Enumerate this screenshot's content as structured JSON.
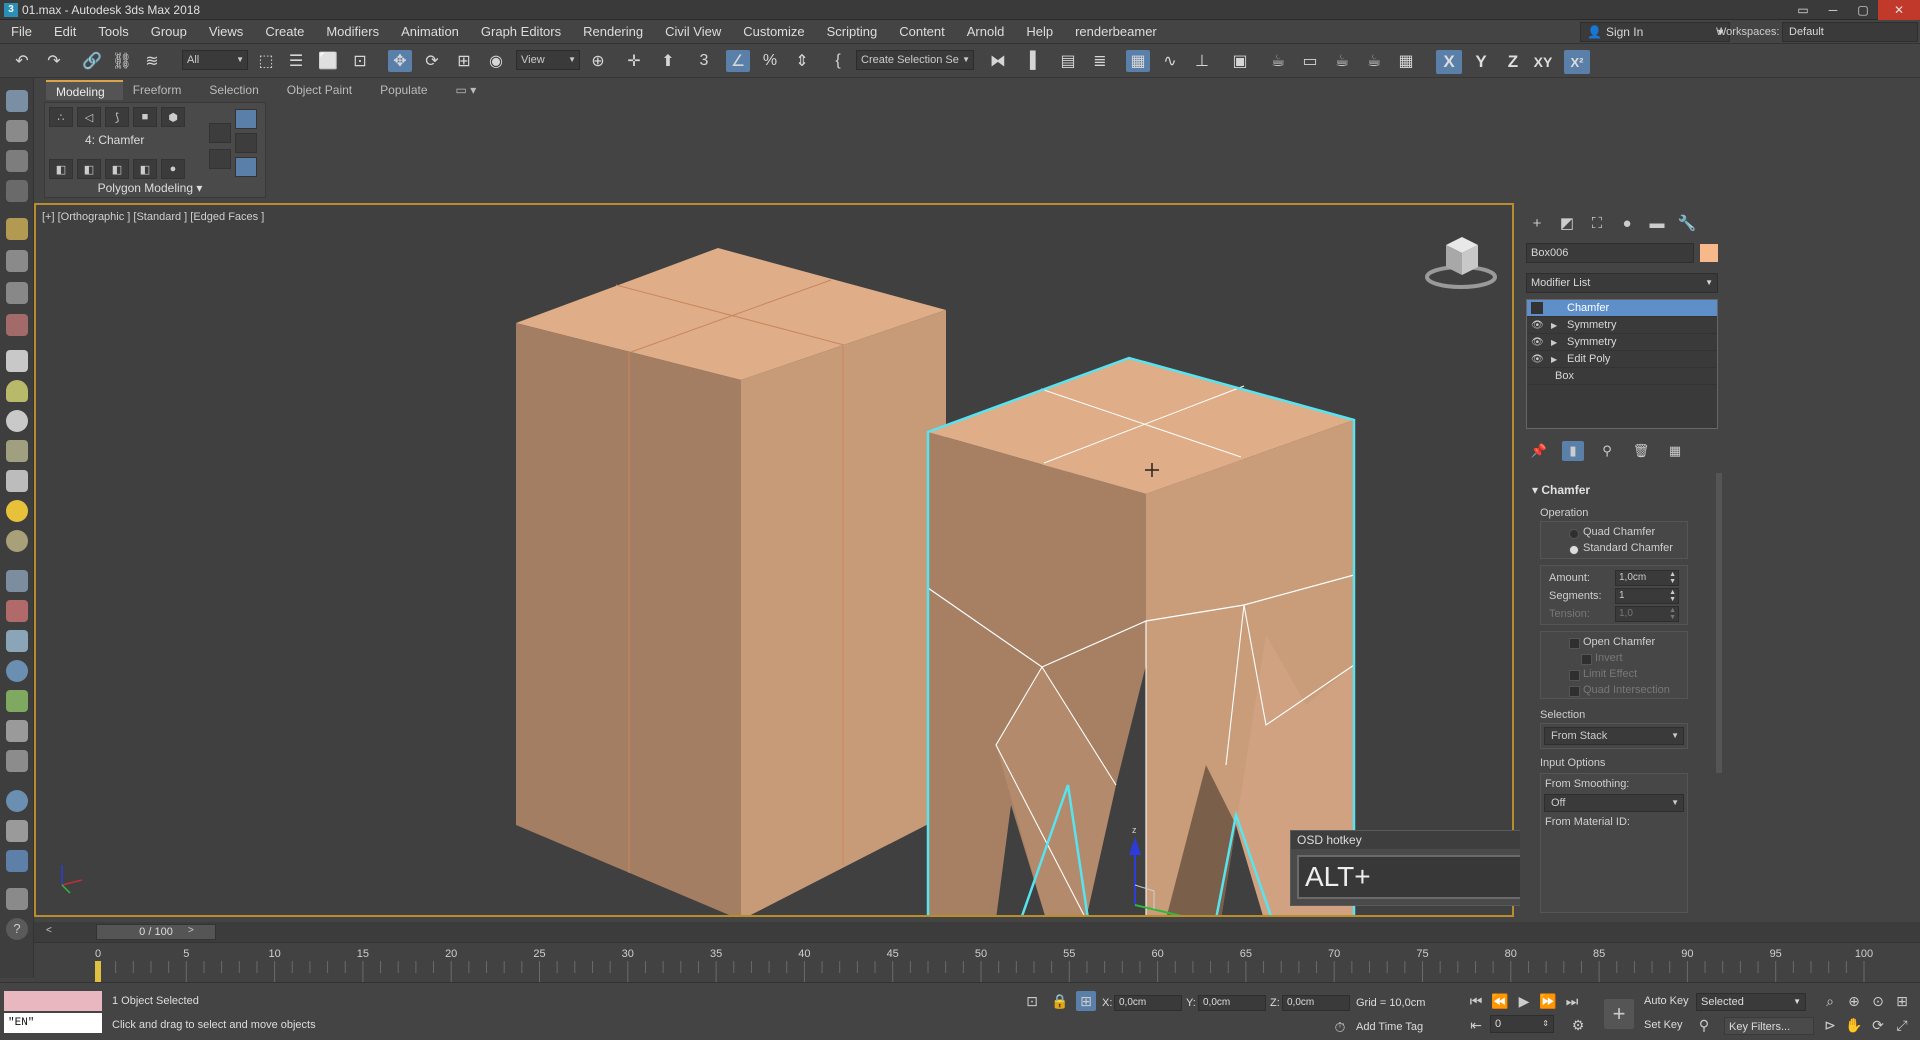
{
  "window": {
    "title": "01.max - Autodesk 3ds Max 2018",
    "app_icon": "3"
  },
  "menu": {
    "items": [
      "File",
      "Edit",
      "Tools",
      "Group",
      "Views",
      "Create",
      "Modifiers",
      "Animation",
      "Graph Editors",
      "Rendering",
      "Civil View",
      "Customize",
      "Scripting",
      "Content",
      "Arnold",
      "Help",
      "renderbeamer"
    ],
    "sign_in": "Sign In",
    "workspaces_label": "Workspaces:",
    "workspaces_value": "Default"
  },
  "toolbar": {
    "filter_value": "All",
    "refcoord_value": "View",
    "selection_set_value": "Create Selection Se",
    "axes": [
      "X",
      "Y",
      "Z",
      "XY"
    ]
  },
  "ribbon": {
    "tabs": [
      "Modeling",
      "Freeform",
      "Selection",
      "Object Paint",
      "Populate"
    ],
    "modifier_label": "4: Chamfer",
    "panel_label": "Polygon Modeling"
  },
  "viewport": {
    "label": "[+] [Orthographic ] [Standard ] [Edged Faces ]",
    "object_color": "#d5a07c",
    "selection_color": "#57e4f0"
  },
  "osd": {
    "title": "OSD hotkey",
    "text": "ALT+"
  },
  "command_panel": {
    "object_name": "Box006",
    "object_color": "#f7b98b",
    "modifier_list": "Modifier List",
    "stack": [
      {
        "label": "Chamfer",
        "selected": true
      },
      {
        "label": "Symmetry",
        "selected": false
      },
      {
        "label": "Symmetry",
        "selected": false
      },
      {
        "label": "Edit Poly",
        "selected": false
      }
    ],
    "stack_base": "Box",
    "rollout": {
      "title": "Chamfer",
      "operation_label": "Operation",
      "quad_chamfer": "Quad Chamfer",
      "standard_chamfer": "Standard Chamfer",
      "amount_label": "Amount:",
      "amount_value": "1,0cm",
      "segments_label": "Segments:",
      "segments_value": "1",
      "tension_label": "Tension:",
      "tension_value": "1,0",
      "open_chamfer": "Open Chamfer",
      "invert": "Invert",
      "limit_effect": "Limit Effect",
      "quad_intersection": "Quad Intersection",
      "selection_label": "Selection",
      "selection_value": "From Stack",
      "input_options_label": "Input Options",
      "from_smoothing_label": "From Smoothing:",
      "from_smoothing_value": "Off",
      "from_material_label": "From Material ID:"
    }
  },
  "timeline": {
    "slider": "0 / 100",
    "ticks": [
      0,
      5,
      10,
      15,
      20,
      25,
      30,
      35,
      40,
      45,
      50,
      55,
      60,
      65,
      70,
      75,
      80,
      85,
      90,
      95,
      100
    ]
  },
  "status": {
    "maxscript_lang": "\"EN\"",
    "objects_selected": "1 Object Selected",
    "prompt": "Click and drag to select and move objects",
    "x_label": "X:",
    "x_value": "0,0cm",
    "y_label": "Y:",
    "y_value": "0,0cm",
    "z_label": "Z:",
    "z_value": "0,0cm",
    "grid": "Grid = 10,0cm",
    "add_time_tag": "Add Time Tag",
    "auto_key": "Auto Key",
    "set_key": "Set Key",
    "key_mode": "Selected",
    "key_filters": "Key Filters...",
    "frame": "0"
  }
}
